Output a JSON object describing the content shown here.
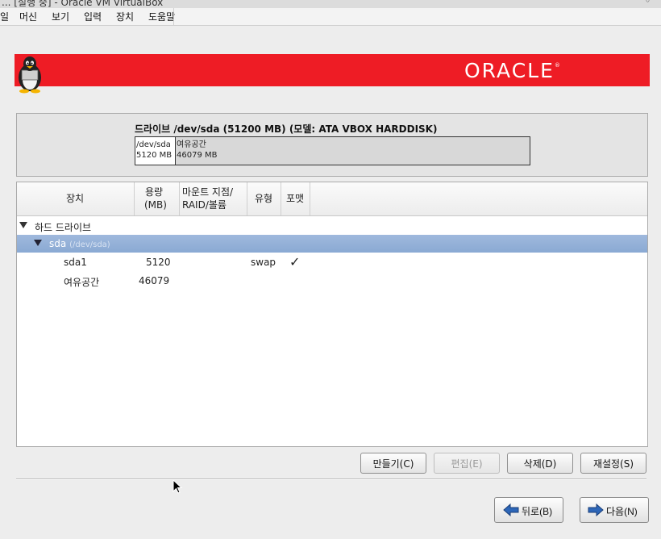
{
  "window": {
    "title": "... [실행 중] - Oracle VM VirtualBox",
    "menu": [
      "일",
      "머신",
      "보기",
      "입력",
      "장치",
      "도움말"
    ]
  },
  "banner": {
    "logo": "ORACLE",
    "trademark": "®"
  },
  "drive": {
    "title": "드라이브 /dev/sda (51200 MB) (모델: ATA VBOX HARDDISK)",
    "segments": [
      {
        "name": "/dev/sda",
        "size": "5120 MB"
      },
      {
        "name": "여유공간",
        "size": "46079 MB"
      }
    ]
  },
  "table": {
    "columns": [
      {
        "line1": "장치",
        "line2": ""
      },
      {
        "line1": "용량",
        "line2": "(MB)"
      },
      {
        "line1": "마운트 지점/",
        "line2": "RAID/볼륨"
      },
      {
        "line1": "유형",
        "line2": ""
      },
      {
        "line1": "포맷",
        "line2": ""
      }
    ],
    "group": "하드 드라이브",
    "disk": {
      "name": "sda",
      "path": "(/dev/sda)"
    },
    "rows": [
      {
        "device": "sda1",
        "size": "5120",
        "mount": "",
        "type": "swap",
        "format": "✓"
      },
      {
        "device": "여유공간",
        "size": "46079",
        "mount": "",
        "type": "",
        "format": ""
      }
    ]
  },
  "actions": {
    "create": "만들기(C)",
    "edit": "편집(E)",
    "delete": "삭제(D)",
    "reset": "재설정(S)"
  },
  "nav": {
    "back": "뒤로(B)",
    "next": "다음(N)"
  },
  "colors": {
    "banner": "#ee1c25",
    "selection": "#8aa9d3"
  }
}
